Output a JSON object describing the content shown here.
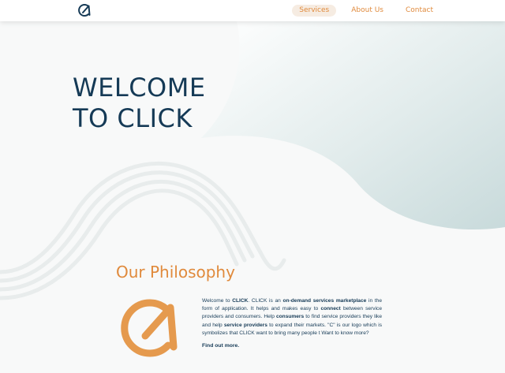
{
  "nav": {
    "items": [
      {
        "label": "Services",
        "active": true
      },
      {
        "label": "About Us",
        "active": false
      },
      {
        "label": "Contact",
        "active": false
      }
    ]
  },
  "hero": {
    "title_line1": "WELCOME",
    "title_line2": "TO CLICK"
  },
  "philosophy": {
    "heading": "Our Philosophy",
    "t1": "Welcome to ",
    "b1": "CLICK",
    "t2": ". CLICK is an ",
    "b2": "on-demand services marketplace",
    "t3": " in the form of application. It helps and makes easy to ",
    "b3": "connect",
    "t4": " between service providers and consumers. Help ",
    "b4": "consumers",
    "t5": " to find service providers they like and help ",
    "b5": "service providers",
    "t6": " to expand their markets. \"C\" is our logo which is symbolizes that CLICK want to bring many people t Want to know more?",
    "find_out": "Find out more."
  },
  "colors": {
    "primary": "#153a56",
    "accent": "#e08a3c",
    "blob": "#d3e1e2",
    "background": "#f8f9f9"
  },
  "icons": {
    "logo": "click-logo-icon"
  }
}
